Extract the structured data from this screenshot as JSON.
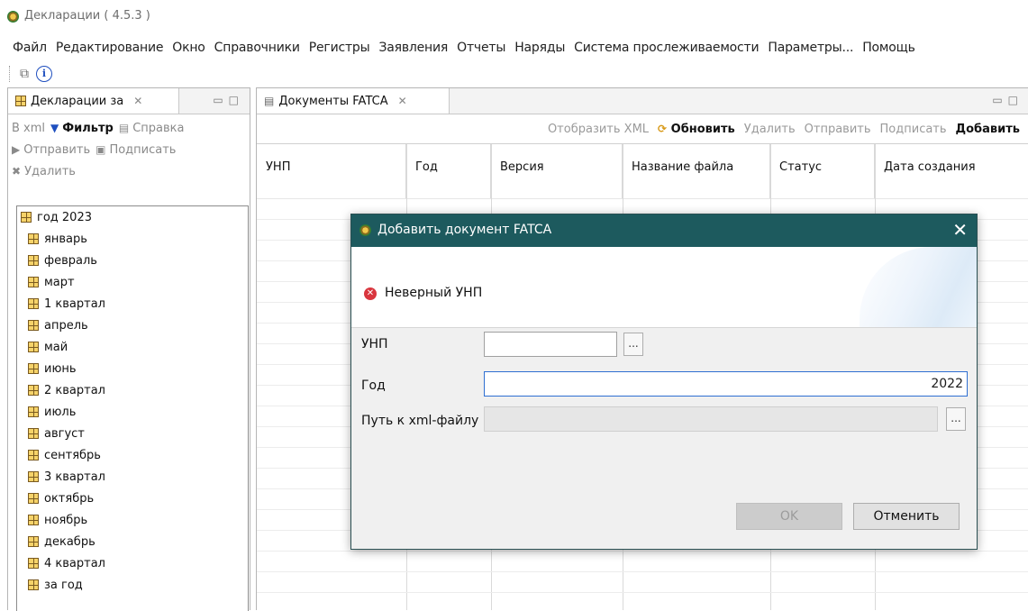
{
  "window": {
    "title": "Декларации ( 4.5.3 )"
  },
  "menu": [
    "Файл",
    "Редактирование",
    "Окно",
    "Справочники",
    "Регистры",
    "Заявления",
    "Отчеты",
    "Наряды",
    "Система прослеживаемости",
    "Параметры...",
    "Помощь"
  ],
  "toolbar": {
    "icons": [
      "copy-icon",
      "info-icon"
    ],
    "info_glyph": "i"
  },
  "left_view": {
    "tab_label": "Декларации за",
    "actions_row1": [
      {
        "label": "В xml",
        "enabled": false
      },
      {
        "label": "Фильтр",
        "enabled": true
      },
      {
        "label": "Справка",
        "enabled": false
      }
    ],
    "actions_row2": [
      {
        "label": "Отправить",
        "enabled": false
      },
      {
        "label": "Подписать",
        "enabled": false
      }
    ],
    "actions_row3": [
      {
        "label": "Удалить",
        "enabled": false
      }
    ],
    "tree": {
      "root": "год 2023",
      "items": [
        "январь",
        "февраль",
        "март",
        "1 квартал",
        "апрель",
        "май",
        "июнь",
        "2 квартал",
        "июль",
        "август",
        "сентябрь",
        "3 квартал",
        "октябрь",
        "ноябрь",
        "декабрь",
        "4 квартал",
        "за год"
      ]
    }
  },
  "editor": {
    "tab_label": "Документы FATCA",
    "actions": [
      {
        "label": "Отобразить XML",
        "enabled": false
      },
      {
        "label": "Обновить",
        "enabled": true
      },
      {
        "label": "Удалить",
        "enabled": false
      },
      {
        "label": "Отправить",
        "enabled": false
      },
      {
        "label": "Подписать",
        "enabled": false
      },
      {
        "label": "Добавить",
        "enabled": true
      }
    ],
    "columns": [
      "УНП",
      "Год",
      "Версия",
      "Название файла",
      "Статус",
      "Дата создания"
    ]
  },
  "dialog": {
    "title": "Добавить документ FATCA",
    "close_glyph": "✕",
    "error_message": "Неверный УНП",
    "fields": {
      "unp_label": "УНП",
      "unp_value": "",
      "year_label": "Год",
      "year_value": "2022",
      "path_label": "Путь к xml-файлу",
      "path_value": ""
    },
    "browse_label": "...",
    "ok_label": "OK",
    "cancel_label": "Отменить"
  },
  "colors": {
    "dialog_title_bg": "#1d5a5e",
    "error_icon": "#d9363e",
    "focus_border": "#2f6fd1"
  }
}
